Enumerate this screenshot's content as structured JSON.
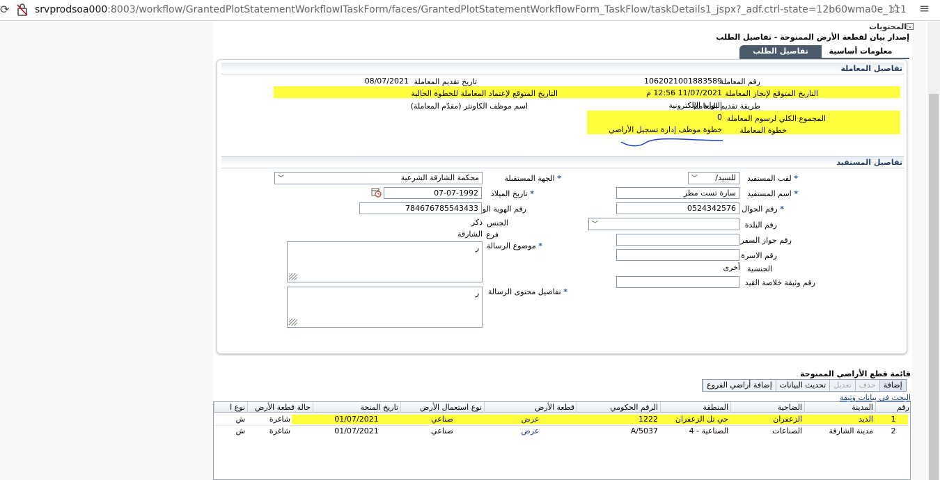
{
  "browser": {
    "url_host": "srvprodsoa000",
    "url_path": ":8003/workflow/GrantedPlotStatementWorkflowITaskForm/faces/GrantedPlotStatementWorkflowForm_TaskFlow/taskDetails1_jspx?_adf.ctrl-state=12b60wma0e_111"
  },
  "page": {
    "contents_header": "المحتويات",
    "title": "إصدار بيان لقطعة الأرض الممنوحة - تفاصيل الطلب",
    "tabs": [
      "معلومات أساسية",
      "تفاصيل الطلب"
    ]
  },
  "transaction": {
    "header": "تفاصيل المعاملة",
    "number_label": "رقم المعاملة",
    "number_value": "1062021001883589",
    "submit_date_label": "تاريخ تقديم المعاملة",
    "submit_date_value": "08/07/2021",
    "expected_completion_label": "التاريخ المتوقع لإنجاز المعاملة",
    "expected_completion_value": "11/07/2021 12:56 م",
    "expected_step_label": "التاريخ المتوقع لإعتماد المعاملة للخطوة الحالية",
    "method_label": "طريقة تقديم المعاملة",
    "method_value": "البوابة الإلكترونية",
    "counter_employee_label": "اسم موظف الكاونتر (مقدّم المعاملة)",
    "total_fees_label": "المجموع الكلي لرسوم المعاملة",
    "total_fees_value": "0",
    "step_label": "خطوة المعاملة",
    "step_value": "خطوة موظف إدارة تسجيل الأراضي"
  },
  "beneficiary": {
    "header": "تفاصيل المستفيد",
    "title_label": "لقب المستفيد",
    "title_value": "للسيد/",
    "receiver_label": "الجهة المستقبلة",
    "receiver_value": "محكمة الشارقة الشرعية",
    "name_label": "اسم المستفيد",
    "name_value": "سارة تست مطر",
    "birth_label": "تاريخ الميلاد",
    "birth_value": "07-07-1992",
    "mobile_label": "رقم الجوال",
    "mobile_value": "0524342576",
    "national_id_label": "رقم الهوية الوطنية",
    "national_id_value": "784676785543433",
    "country_label": "رقم البلدة",
    "gender_label": "الجنس",
    "gender_value": "ذكر",
    "branch_label": "فرع",
    "branch_value": "الشارقة",
    "passport_label": "رقم جواز السفر",
    "subject_label": "موضوع الرسالة",
    "subject_value": "ر",
    "family_label": "رقم الاسرة",
    "nationality_label": "الجنسية",
    "nationality_value": "أخرى",
    "record_label": "رقم وثيقة خلاصة القيد",
    "content_label": "تفاصيل محتوى الرسالة",
    "content_value": "ر"
  },
  "plots": {
    "title": "قائمة قطع الأراضي الممنوحة",
    "toolbar": [
      "إضافة",
      "حذف",
      "تعديل",
      "تحديث البيانات",
      "إضافة أراضي الفروع"
    ],
    "search_link": "البحث في بيانات وثيقة",
    "columns": [
      "رقم",
      "المدينة",
      "الضاحية",
      "المنطقة",
      "الرقم الحكومي",
      "قطعة الأرض",
      "نوع استعمال الأرض",
      "تاريخ المنحة",
      "حالة قطعة الأرض",
      "نوع ا"
    ],
    "rows": [
      [
        "1",
        "الذيد",
        "الزعفران",
        "حي تل الزعفران",
        "1222",
        "عرض",
        "صناعي",
        "01/07/2021",
        "شاغرة",
        "ش"
      ],
      [
        "2",
        "مدينة الشارقة",
        "الصناعات",
        "الصناعية - 4",
        "A/5037",
        "عرض",
        "صناعي",
        "01/07/2021",
        "شاغرة",
        "ش"
      ]
    ]
  },
  "colors": {
    "highlight": "#ffff40",
    "tab_active": "#4a5a6a",
    "section_header": "#1f3a5c"
  }
}
